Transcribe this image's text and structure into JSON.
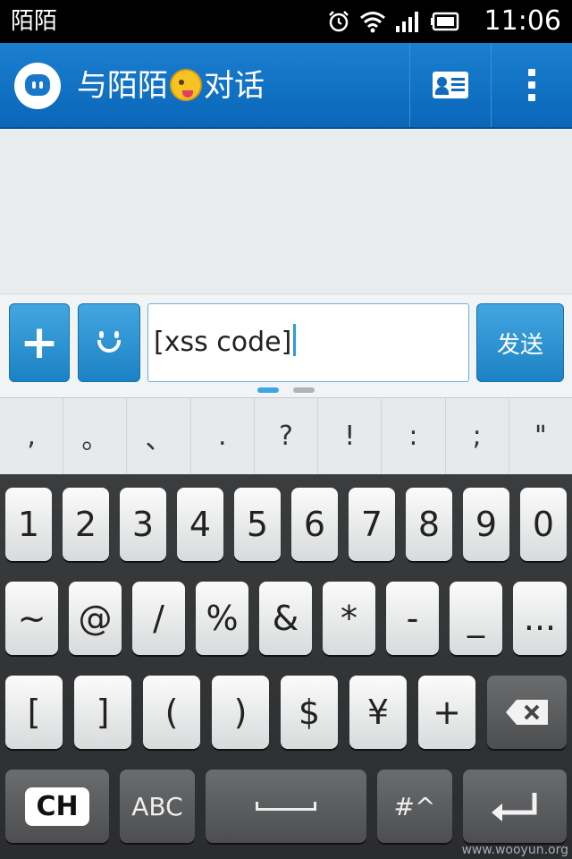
{
  "status_bar": {
    "app_name": "陌陌",
    "time": "11:06",
    "icons": [
      "alarm-icon",
      "wifi-icon",
      "signal-icon",
      "battery-icon"
    ]
  },
  "title_bar": {
    "title_prefix": "与陌陌",
    "title_suffix": "对话",
    "emoji": "winking-tongue-emoji",
    "actions": [
      "profile-card-icon",
      "overflow-menu-icon"
    ]
  },
  "input_bar": {
    "text_value": "[xss code]",
    "send_label": "发送"
  },
  "symbol_strip": [
    ",",
    "。",
    "、",
    ".",
    "?",
    "!",
    ":",
    ";",
    "\""
  ],
  "keyboard": {
    "row1": [
      "1",
      "2",
      "3",
      "4",
      "5",
      "6",
      "7",
      "8",
      "9",
      "0"
    ],
    "row2": [
      "~",
      "@",
      "/",
      "%",
      "&",
      "*",
      "-",
      "_",
      "..."
    ],
    "row3": [
      "[",
      "]",
      "(",
      ")",
      "$",
      "¥",
      "+"
    ],
    "ch_label": "CH",
    "abc_label": "ABC",
    "symbol_label": "#^"
  },
  "watermark": "www.wooyun.org",
  "colors": {
    "title_bar": "#0a6fbf",
    "button_blue": "#2f96d6",
    "keyboard_bg": "#2f3032"
  }
}
